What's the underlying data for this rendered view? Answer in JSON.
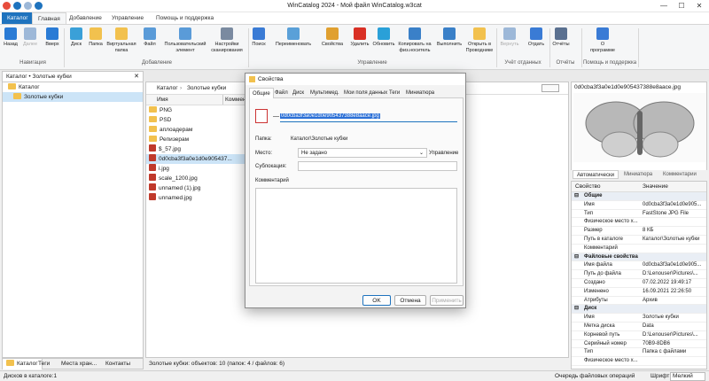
{
  "window": {
    "title": "WinCatalog 2024 - Мой файл WinCatalog.w3cat",
    "minimize": "—",
    "maximize": "☐",
    "close": "✕"
  },
  "ribbon_tabs": [
    "Каталог",
    "Главная",
    "Добавление",
    "Управление",
    "Помощь и поддержка"
  ],
  "ribbon": {
    "buttons": [
      {
        "label": "Назад",
        "color": "#2a7bd5"
      },
      {
        "label": "Далее",
        "color": "#9db8d8"
      },
      {
        "label": "Вверх",
        "color": "#2a7bd5"
      },
      {
        "label": "Диск",
        "color": "#3aa0d8"
      },
      {
        "label": "Папка",
        "color": "#f2c14e"
      },
      {
        "label": "Виртуальная\nпапка",
        "color": "#f2c14e"
      },
      {
        "label": "Файл",
        "color": "#5a9bd8"
      },
      {
        "label": "Пользовательский\nэлемент",
        "color": "#5a9bd8"
      },
      {
        "label": "Настройки\nсканирования",
        "color": "#7a8aa0"
      },
      {
        "label": "Поиск",
        "color": "#3a7bd5"
      },
      {
        "label": "Переименовать",
        "color": "#5aa0d8"
      },
      {
        "label": "Свойства",
        "color": "#e0a030"
      },
      {
        "label": "Удалить",
        "color": "#d93025"
      },
      {
        "label": "Обновить",
        "color": "#2aa0d8"
      },
      {
        "label": "Копировать на\nфиз.носитель",
        "color": "#3a80c8"
      },
      {
        "label": "Выполнить",
        "color": "#3a80c8"
      },
      {
        "label": "Открыть в\nПроводнике",
        "color": "#f2c14e"
      },
      {
        "label": "Вернуть",
        "color": "#9db8d8"
      },
      {
        "label": "Отдать",
        "color": "#3a7bd5"
      },
      {
        "label": "Отчёты",
        "color": "#5a7090"
      },
      {
        "label": "О\nпрограмме",
        "color": "#3a7bd5"
      }
    ],
    "groups": [
      "Навигация",
      "Добавление",
      "Управление",
      "Учёт отданных",
      "Отчёты",
      "Помощь и поддержка"
    ]
  },
  "left_panel": {
    "header": "Каталог • Золотые кубки",
    "tree": [
      "Каталог",
      "Золотые кубки"
    ],
    "tabs": [
      "Каталог",
      "Теги",
      "Места хран...",
      "Контакты"
    ]
  },
  "center_panel": {
    "breadcrumb": [
      "Каталог",
      "Золотые кубки"
    ],
    "columns": [
      "Имя",
      "Коммент"
    ],
    "items": [
      {
        "name": "PNG",
        "type": "folder"
      },
      {
        "name": "PSD",
        "type": "folder"
      },
      {
        "name": "аплоадерам",
        "type": "folder"
      },
      {
        "name": "Репизерам",
        "type": "folder"
      },
      {
        "name": "$_57.jpg",
        "type": "jpg"
      },
      {
        "name": "0d0cba3f3a0e1d0e905437...",
        "type": "jpg",
        "selected": true
      },
      {
        "name": "i.jpg",
        "type": "jpg"
      },
      {
        "name": "scale_1200.jpg",
        "type": "jpg"
      },
      {
        "name": "unnamed (1).jpg",
        "type": "jpg"
      },
      {
        "name": "unnamed.jpg",
        "type": "jpg"
      }
    ],
    "status": "Золотые кубки: объектов: 10 (папок: 4 / файлов: 6)"
  },
  "right_panel": {
    "title": "0d0cba3f3a0e1d0e905437388e8aace.jpg",
    "preview_tabs": [
      "Автоматически",
      "Миниатюра",
      "Комментарии"
    ],
    "columns": [
      "Свойство",
      "Значение"
    ],
    "sections": [
      {
        "name": "Общие",
        "rows": [
          [
            "Имя",
            "0d0cba3f3a0e1d0e905..."
          ],
          [
            "Тип",
            "FastStone JPG File"
          ],
          [
            "Физическое место х...",
            ""
          ],
          [
            "Размер",
            "8 КБ"
          ],
          [
            "Путь в каталоге",
            "Каталог\\Золотые кубки"
          ],
          [
            "Комментарий",
            ""
          ]
        ]
      },
      {
        "name": "Файловые свойства",
        "rows": [
          [
            "Имя файла",
            "0d0cba3f3a0e1d0e905..."
          ],
          [
            "Путь до файла",
            "D:\\Lenouser\\Pictures\\..."
          ],
          [
            "Создано",
            "07.02.2022 19:49:17"
          ],
          [
            "Изменено",
            "16.09.2021 22:26:50"
          ],
          [
            "Атрибуты",
            "Архив"
          ]
        ]
      },
      {
        "name": "Диск",
        "rows": [
          [
            "Имя",
            "Золотые кубки"
          ],
          [
            "Метка диска",
            "Data"
          ],
          [
            "Корневой путь",
            "D:\\Lenouser\\Pictures\\..."
          ],
          [
            "Серийный номер",
            "70B9-8DB6"
          ],
          [
            "Тип",
            "Папка с файлами"
          ],
          [
            "Физическое место х...",
            ""
          ]
        ]
      }
    ]
  },
  "dialog": {
    "title": "Свойства",
    "tabs": [
      "Общие",
      "Файл",
      "Диск",
      "Мультимед.",
      "Мои поля данных",
      "Теги",
      "Миниатюра"
    ],
    "name_value": "0d0cba3f3a0e1d0e905437388e8aace.jpg",
    "folder_label": "Папка:",
    "folder_value": "Каталог\\Золотые кубки",
    "location_label": "Место:",
    "location_value": "Не задано",
    "manage_label": "Управление",
    "sublocation_label": "Сублокация:",
    "comment_label": "Комментарий",
    "ok": "OK",
    "cancel": "Отмена",
    "apply": "Применить"
  },
  "statusbar": {
    "left": "Дисков в каталоге:1",
    "queue": "Очередь файловых операций",
    "font_label": "Шрифт:",
    "font_value": "Мелкий"
  }
}
